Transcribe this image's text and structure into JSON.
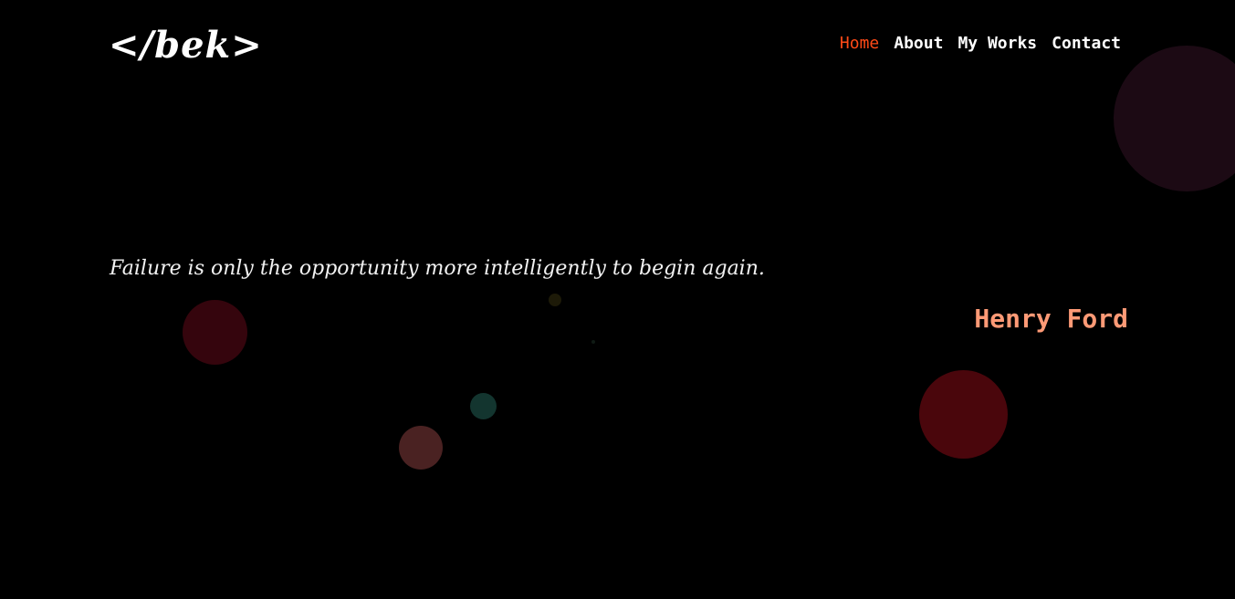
{
  "header": {
    "logo_text": "</bek>",
    "nav": [
      {
        "label": "Home",
        "active": true
      },
      {
        "label": "About",
        "active": false
      },
      {
        "label": "My Works",
        "active": false
      },
      {
        "label": "Contact",
        "active": false
      }
    ]
  },
  "hero": {
    "quote": "Failure is only the opportunity more intelligently to begin again.",
    "author": "Henry Ford"
  },
  "colors": {
    "background": "#000000",
    "accent": "#ff4a17",
    "author": "#ff9a76"
  }
}
